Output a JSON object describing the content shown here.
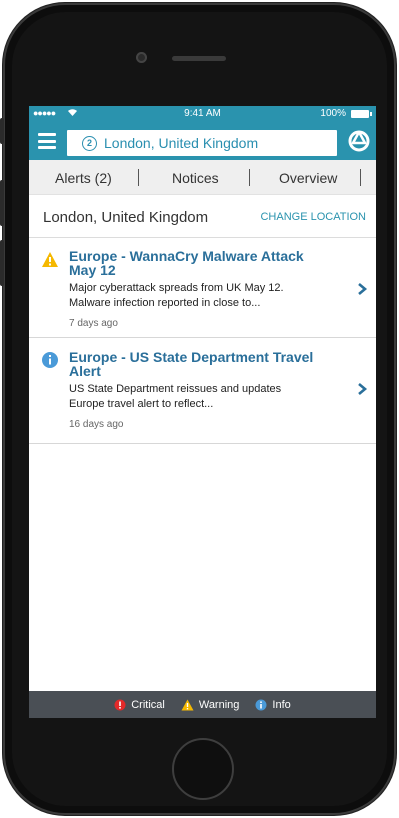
{
  "status_bar": {
    "signal": "●●●●●",
    "time": "9:41 AM",
    "battery_percent": "100%"
  },
  "header": {
    "search_value": "London, United Kingdom",
    "location_badge": "2"
  },
  "tabs": [
    {
      "label": "Alerts (2)",
      "active": true
    },
    {
      "label": "Notices",
      "active": false
    },
    {
      "label": "Overview",
      "active": false
    }
  ],
  "location": {
    "title": "London, United Kingdom",
    "change_label": "CHANGE LOCATION"
  },
  "alerts": [
    {
      "level": "warning",
      "title_line1": "Europe - WannaCry Malware Attack",
      "title_line2": "May 12",
      "desc_line1": "Major cyberattack spreads from UK May 12.",
      "desc_line2": "Malware infection reported in close to...",
      "age": "7 days ago"
    },
    {
      "level": "info",
      "title_line1": "Europe - US State Department Travel",
      "title_line2": "Alert",
      "desc_line1": "US State Department reissues and updates",
      "desc_line2": "Europe travel alert to reflect...",
      "age": "16 days ago"
    }
  ],
  "legend": {
    "critical": "Critical",
    "warning": "Warning",
    "info": "Info"
  },
  "colors": {
    "brand": "#2a93ae",
    "title": "#2a6f9a",
    "critical": "#e32a2a",
    "warning": "#f5b800",
    "info": "#4a9ad8",
    "legend_bg": "#4a4f55"
  }
}
